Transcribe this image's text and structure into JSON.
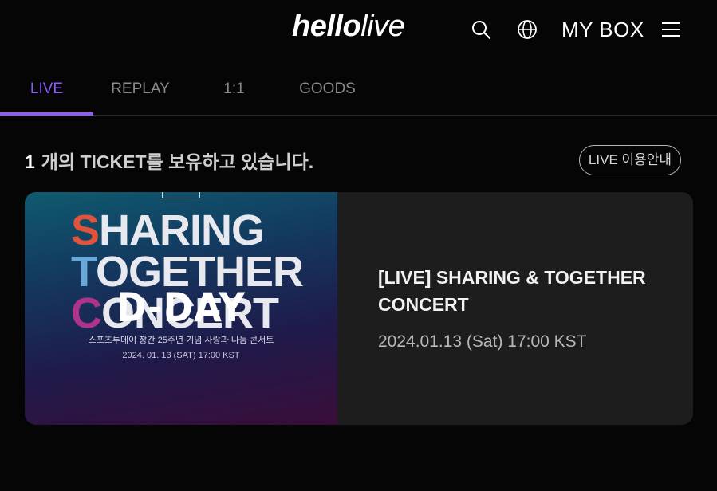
{
  "header": {
    "logo_bold": "hello",
    "logo_light": "live",
    "mybox_label": "MY BOX",
    "icons": [
      "search-icon",
      "globe-icon",
      "menu-icon"
    ]
  },
  "tabs": [
    {
      "label": "LIVE",
      "active": true
    },
    {
      "label": "REPLAY",
      "active": false
    },
    {
      "label": "1:1",
      "active": false
    },
    {
      "label": "GOODS",
      "active": false
    }
  ],
  "summary": {
    "count": "1",
    "text": "개의 TICKET를 보유하고 있습니다.",
    "guide_button": "LIVE 이용안내"
  },
  "ticket": {
    "poster": {
      "line1_first": "S",
      "line1_rest": "HARING",
      "line2_first": "T",
      "line2_rest": "OGETHER",
      "line3_first": "C",
      "line3_rest": "ONCERT",
      "subtitle": "스포츠투데이 창간 25주년 기념 사랑과 나눔 콘서트",
      "date": "2024. 01. 13 (SAT) 17:00 KST",
      "badge": "D-DAY"
    },
    "title": "[LIVE] SHARING & TOGETHER CONCERT",
    "datetime": "2024.01.13 (Sat) 17:00 KST"
  },
  "colors": {
    "accent": "#8b5cf6",
    "background": "#050505",
    "card": "#1d1d1d"
  }
}
